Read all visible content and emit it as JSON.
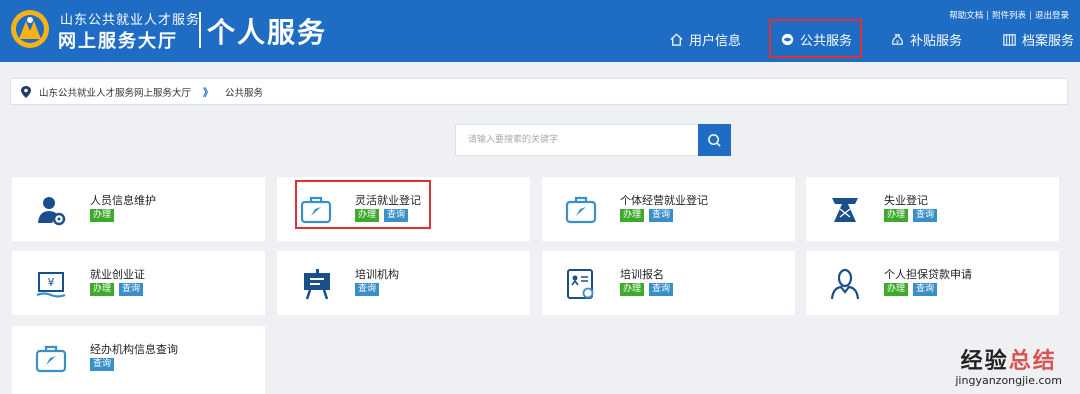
{
  "header": {
    "brand_line1": "山东公共就业人才服务",
    "brand_line2": "网上服务大厅",
    "title": "个人服务",
    "toplinks": [
      "帮助文档",
      "附件列表",
      "退出登录"
    ],
    "nav": [
      {
        "label": "用户信息",
        "icon": "home-icon"
      },
      {
        "label": "公共服务",
        "icon": "globe-icon",
        "active": true
      },
      {
        "label": "补贴服务",
        "icon": "money-bag-icon"
      },
      {
        "label": "档案服务",
        "icon": "archive-icon"
      }
    ]
  },
  "breadcrumb": {
    "icon": "location-pin-icon",
    "items": [
      "山东公共就业人才服务网上服务大厅",
      "公共服务"
    ],
    "separator": "》"
  },
  "search": {
    "placeholder": "请输入要搜索的关键字",
    "icon": "search-icon"
  },
  "tag_labels": {
    "handle": "办理",
    "query": "查询"
  },
  "cards": [
    {
      "title": "人员信息维护",
      "icon": "user-gear-icon",
      "tags": [
        "办理"
      ]
    },
    {
      "title": "灵活就业登记",
      "icon": "briefcase-icon",
      "tags": [
        "办理",
        "查询"
      ]
    },
    {
      "title": "个体经营就业登记",
      "icon": "briefcase-icon",
      "tags": [
        "办理",
        "查询"
      ]
    },
    {
      "title": "失业登记",
      "icon": "tie-icon",
      "tags": [
        "办理",
        "查询"
      ]
    },
    {
      "title": "就业创业证",
      "icon": "certificate-icon",
      "tags": [
        "办理",
        "查询"
      ]
    },
    {
      "title": "培训机构",
      "icon": "easel-icon",
      "tags": [
        "查询"
      ]
    },
    {
      "title": "培训报名",
      "icon": "training-signup-icon",
      "tags": [
        "办理",
        "查询"
      ]
    },
    {
      "title": "个人担保贷款申请",
      "icon": "person-icon",
      "tags": [
        "办理",
        "查询"
      ]
    },
    {
      "title": "经办机构信息查询",
      "icon": "briefcase-icon",
      "tags": [
        "查询"
      ]
    }
  ],
  "colors": {
    "header_bg": "#1e6cc4",
    "tag_handle": "#3fa92b",
    "tag_query": "#3a8fc8",
    "highlight": "#e03131"
  },
  "watermark": {
    "line1_part1": "经验",
    "line1_part2": "总结",
    "line2": "jingyanzongjie.com"
  }
}
